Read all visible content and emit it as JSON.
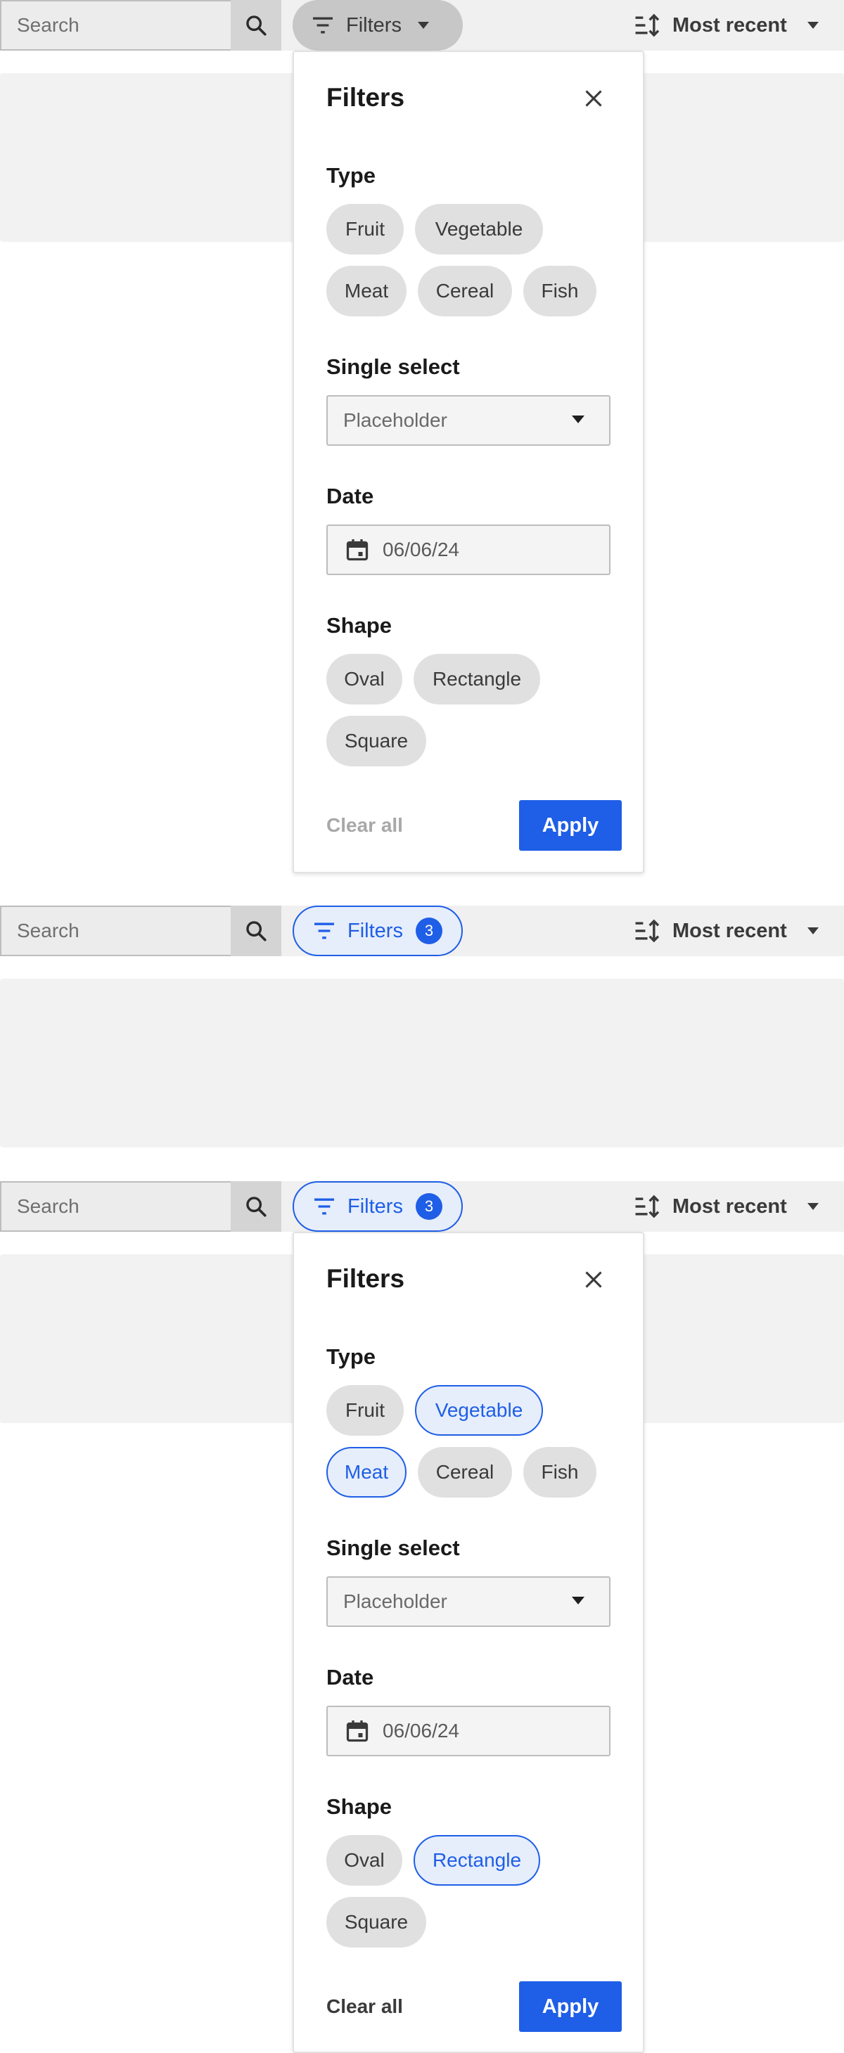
{
  "toolbar": {
    "search_placeholder": "Search",
    "filters_label": "Filters",
    "filters_count": "3",
    "sort_label": "Most recent"
  },
  "panel": {
    "title": "Filters",
    "type_title": "Type",
    "type_options": [
      "Fruit",
      "Vegetable",
      "Meat",
      "Cereal",
      "Fish"
    ],
    "single_select_title": "Single select",
    "single_select_placeholder": "Placeholder",
    "date_title": "Date",
    "date_value": "06/06/24",
    "shape_title": "Shape",
    "shape_options": [
      "Oval",
      "Rectangle",
      "Square"
    ],
    "clear_label": "Clear all",
    "apply_label": "Apply"
  },
  "selected_state": {
    "type_selected": [
      "Vegetable",
      "Meat"
    ],
    "shape_selected": [
      "Rectangle"
    ]
  },
  "colors": {
    "accent": "#1f5ee6",
    "chip_bg": "#e0e0e0",
    "selected_chip_bg": "#e6eefc",
    "toolbar_bg": "#f0f0f0"
  }
}
